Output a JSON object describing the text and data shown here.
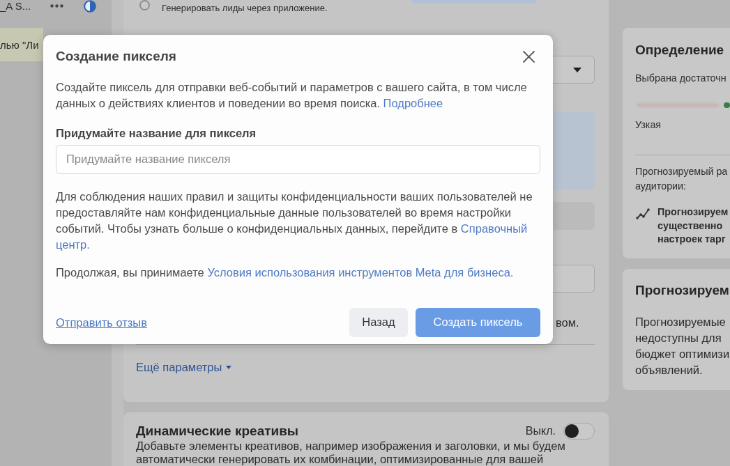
{
  "sidebar": {
    "items": [
      {
        "label": "_A S...",
        "selected": false
      },
      {
        "label": "лью \"Ли",
        "selected": true
      }
    ]
  },
  "main": {
    "lead_option": {
      "label": "Генерировать лиды через приложение.",
      "selected": false
    },
    "text_fragment": "вом.",
    "more_link": "Ещё параметры"
  },
  "dynamic_creatives": {
    "title": "Динамические креативы",
    "toggle_label": "Выкл.",
    "on": false,
    "description": "Добавьте элементы креативов, например изображения и заголовки, и мы будем автоматически генерировать их комбинации, оптимизированные для вашей"
  },
  "audience_card": {
    "title": "Определение",
    "summary": "Выбрана достаточн",
    "scale_label": "Узкая",
    "estimate_lines": [
      "Прогнозируемый ра",
      "аудитории:"
    ],
    "note_lines": [
      "Прогнозируем",
      "существенно",
      "настроек тарг"
    ]
  },
  "results_card": {
    "title": "Прогнозируем",
    "lines": [
      "Прогнозируемые",
      "недоступны для",
      "бюджет оптимизи",
      "объявлений."
    ]
  },
  "modal": {
    "title": "Создание пикселя",
    "description": {
      "text": "Создайте пиксель для отправки веб-событий и параметров с вашего сайта, в том числе данных о действиях клиентов и поведении во время поиска.",
      "link": "Подробнее"
    },
    "name_label": "Придумайте название для пикселя",
    "name_field": {
      "placeholder": "Придумайте название пикселя"
    },
    "privacy": {
      "text": "Для соблюдения наших правил и защиты конфиденциальности ваших пользователей не предоставляйте нам конфиденциальные данные пользователей во время настройки событий. Чтобы узнать больше о конфиденциальных данных, перейдите в",
      "link_lines": [
        "Справочный",
        "центр."
      ]
    },
    "terms": {
      "text": "Продолжая, вы принимаете",
      "link": "Условия использования инструментов Meta для бизнеса."
    },
    "feedback_link": "Отправить отзыв",
    "buttons": [
      {
        "label": "Назад",
        "kind": "secondary",
        "disabled": false
      },
      {
        "label": "Создать пиксель",
        "kind": "primary",
        "disabled": true
      }
    ]
  }
}
